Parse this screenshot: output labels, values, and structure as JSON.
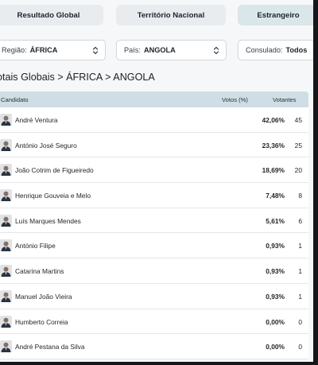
{
  "tabs": [
    {
      "label": "Resultado Global"
    },
    {
      "label": "Território Nacional"
    },
    {
      "label": "Estrangeiro"
    }
  ],
  "filters": {
    "region": {
      "label": "Região:",
      "value": "ÁFRICA"
    },
    "country": {
      "label": "País:",
      "value": "ANGOLA"
    },
    "consulate": {
      "label": "Consulado:",
      "value": "Todos"
    }
  },
  "title": "otais Globais > ÁFRICA > ANGOLA",
  "table": {
    "headers": {
      "candidate": "Candidato",
      "percent": "Votos (%)",
      "votes": "Votantes"
    },
    "rows": [
      {
        "name": "André Ventura",
        "percent": "42,06%",
        "votes": "45"
      },
      {
        "name": "António José Seguro",
        "percent": "23,36%",
        "votes": "25"
      },
      {
        "name": "João Cotrim de Figueiredo",
        "percent": "18,69%",
        "votes": "20"
      },
      {
        "name": "Henrique Gouveia e Melo",
        "percent": "7,48%",
        "votes": "8"
      },
      {
        "name": "Luís Marques Mendes",
        "percent": "5,61%",
        "votes": "6"
      },
      {
        "name": "António Filipe",
        "percent": "0,93%",
        "votes": "1"
      },
      {
        "name": "Catarina Martins",
        "percent": "0,93%",
        "votes": "1"
      },
      {
        "name": "Manuel João Vieira",
        "percent": "0,93%",
        "votes": "1"
      },
      {
        "name": "Humberto Correia",
        "percent": "0,00%",
        "votes": "0"
      },
      {
        "name": "André Pestana da Silva",
        "percent": "0,00%",
        "votes": "0"
      }
    ]
  },
  "colors": {
    "tab_active": "#d9e6ea",
    "tab_inactive": "#e9ecef",
    "table_header": "#cfdde4"
  }
}
